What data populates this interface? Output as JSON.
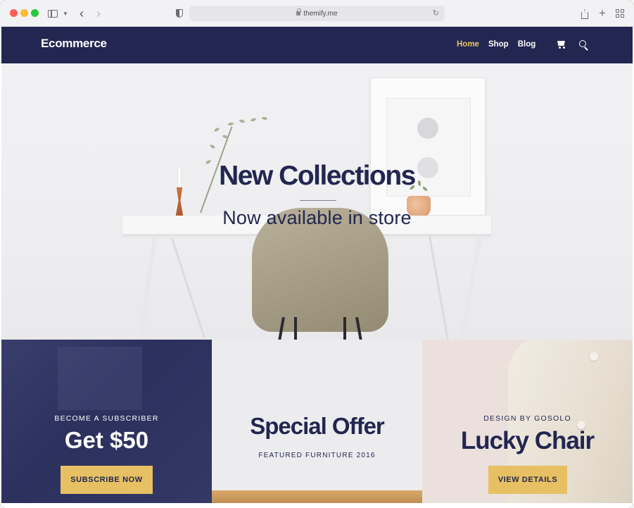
{
  "browser": {
    "url": "themify.me",
    "icons": [
      "sidebar-toggle-icon",
      "chevron-down-icon",
      "back-icon",
      "forward-icon",
      "privacy-shield-icon",
      "lock-icon",
      "reload-icon",
      "share-icon",
      "new-tab-icon",
      "tab-overview-icon"
    ]
  },
  "site": {
    "brand": "Ecommerce",
    "nav": {
      "home": "Home",
      "shop": "Shop",
      "blog": "Blog"
    },
    "accent": "#e8c46a",
    "navy": "#222650"
  },
  "hero": {
    "title": "New Collections",
    "subtitle": "Now available in store"
  },
  "promos": {
    "subscriber": {
      "eyebrow": "BECOME A SUBSCRIBER",
      "headline": "Get $50",
      "cta": "SUBSCRIBE NOW"
    },
    "offer": {
      "headline": "Special Offer",
      "caption": "FEATURED FURNITURE 2016"
    },
    "chair": {
      "eyebrow": "DESIGN BY GOSOLO",
      "headline": "Lucky Chair",
      "cta": "VIEW DETAILS"
    }
  }
}
